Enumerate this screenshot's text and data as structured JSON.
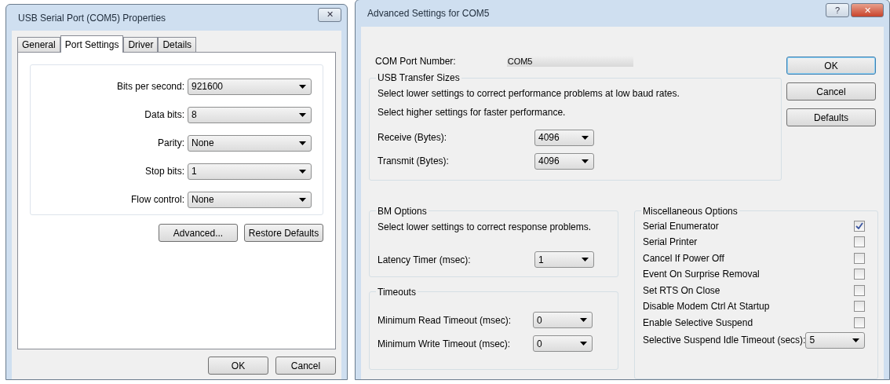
{
  "port_properties": {
    "title": "USB Serial Port (COM5) Properties",
    "close": "✕",
    "tabs": [
      {
        "label": "General",
        "selected": false
      },
      {
        "label": "Port Settings",
        "selected": true
      },
      {
        "label": "Driver",
        "selected": false
      },
      {
        "label": "Details",
        "selected": false
      }
    ],
    "fields": [
      {
        "label": "Bits per second:",
        "value": "921600"
      },
      {
        "label": "Data bits:",
        "value": "8"
      },
      {
        "label": "Parity:",
        "value": "None"
      },
      {
        "label": "Stop bits:",
        "value": "1"
      },
      {
        "label": "Flow control:",
        "value": "None"
      }
    ],
    "panel_buttons": [
      "Advanced...",
      "Restore Defaults"
    ],
    "footer_buttons": [
      "OK",
      "Cancel"
    ]
  },
  "advanced_settings": {
    "title": "Advanced Settings for COM5",
    "help": "?",
    "close": "✕",
    "com_port": {
      "label": "COM Port Number:",
      "value": "COM5"
    },
    "usb_transfer_sizes": {
      "title": "USB Transfer Sizes",
      "notes": [
        "Select lower settings to correct performance problems at low baud rates.",
        "Select higher settings for faster performance."
      ],
      "fields": [
        {
          "label": "Receive (Bytes):",
          "value": "4096"
        },
        {
          "label": "Transmit (Bytes):",
          "value": "4096"
        }
      ]
    },
    "bm_options": {
      "title": "BM Options",
      "note": "Select lower settings to correct response problems.",
      "fields": [
        {
          "label": "Latency Timer (msec):",
          "value": "1"
        }
      ]
    },
    "timeouts": {
      "title": "Timeouts",
      "fields": [
        {
          "label": "Minimum Read Timeout (msec):",
          "value": "0"
        },
        {
          "label": "Minimum Write Timeout (msec):",
          "value": "0"
        }
      ]
    },
    "miscellaneous_options": {
      "title": "Miscellaneous Options",
      "options": [
        {
          "label": "Serial Enumerator",
          "checked": true
        },
        {
          "label": "Serial Printer",
          "checked": false
        },
        {
          "label": "Cancel If Power Off",
          "checked": false
        },
        {
          "label": "Event On Surprise Removal",
          "checked": false
        },
        {
          "label": "Set RTS On Close",
          "checked": false
        },
        {
          "label": "Disable Modem Ctrl At Startup",
          "checked": false
        },
        {
          "label": "Enable Selective Suspend",
          "checked": false
        }
      ],
      "fields": [
        {
          "label": "Selective Suspend Idle Timeout (secs):",
          "value": "5"
        }
      ]
    },
    "buttons": [
      {
        "label": "OK",
        "default": true
      },
      {
        "label": "Cancel",
        "default": false
      },
      {
        "label": "Defaults",
        "default": false
      }
    ]
  }
}
